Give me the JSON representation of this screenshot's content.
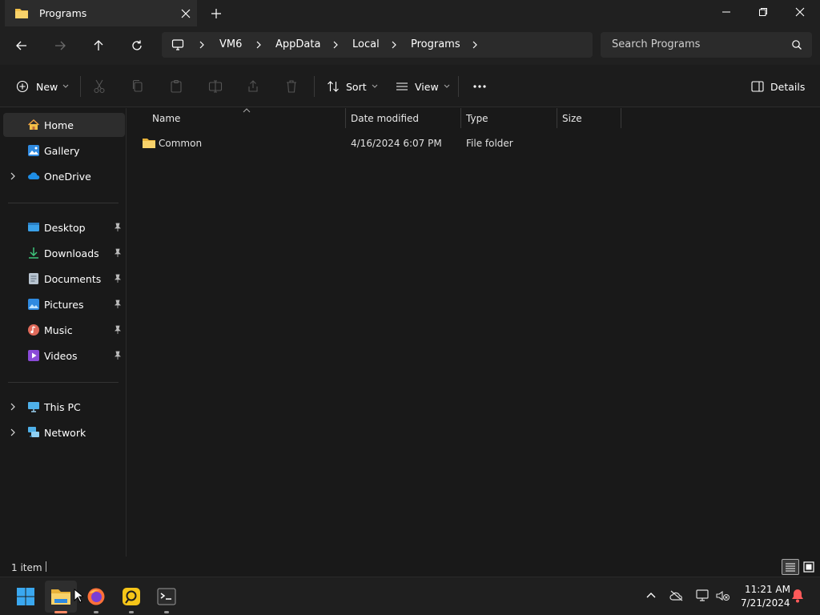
{
  "window": {
    "tab_title": "Programs",
    "colors": {
      "accent": "#60cdff",
      "folder": "#f3c047"
    }
  },
  "nav": {
    "breadcrumbs": [
      "VM6",
      "AppData",
      "Local",
      "Programs"
    ],
    "search_placeholder": "Search Programs"
  },
  "toolbar": {
    "new_label": "New",
    "sort_label": "Sort",
    "view_label": "View",
    "details_label": "Details"
  },
  "sidebar": {
    "top": [
      {
        "label": "Home",
        "icon": "home-icon",
        "selected": true
      },
      {
        "label": "Gallery",
        "icon": "gallery-icon"
      },
      {
        "label": "OneDrive",
        "icon": "onedrive-icon",
        "expandable": true
      }
    ],
    "pinned": [
      {
        "label": "Desktop",
        "icon": "desktop-icon"
      },
      {
        "label": "Downloads",
        "icon": "downloads-icon"
      },
      {
        "label": "Documents",
        "icon": "documents-icon"
      },
      {
        "label": "Pictures",
        "icon": "pictures-icon"
      },
      {
        "label": "Music",
        "icon": "music-icon"
      },
      {
        "label": "Videos",
        "icon": "videos-icon"
      }
    ],
    "bottom": [
      {
        "label": "This PC",
        "icon": "this-pc-icon"
      },
      {
        "label": "Network",
        "icon": "network-icon"
      }
    ]
  },
  "content": {
    "columns": [
      "Name",
      "Date modified",
      "Type",
      "Size"
    ],
    "rows": [
      {
        "name": "Common",
        "date": "4/16/2024 6:07 PM",
        "type": "File folder",
        "size": ""
      }
    ]
  },
  "status": {
    "item_count": "1 item"
  },
  "taskbar": {
    "time": "11:21 AM",
    "date": "7/21/2024",
    "apps": [
      "start-icon",
      "file-explorer-icon",
      "firefox-icon",
      "app-icon",
      "terminal-icon"
    ]
  }
}
